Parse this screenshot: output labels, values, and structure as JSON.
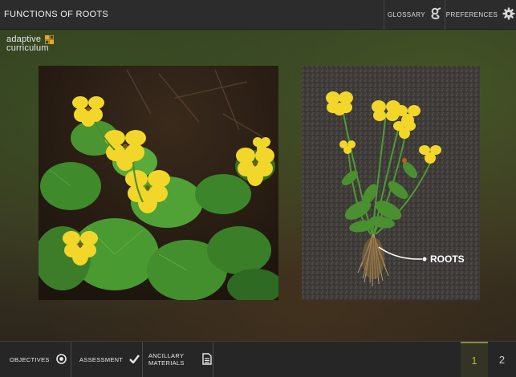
{
  "header": {
    "title": "FUNCTIONS OF ROOTS",
    "glossary_label": "GLOSSARY",
    "preferences_label": "PREFERENCES"
  },
  "logo": {
    "line1": "adaptive",
    "line2": "curriculum"
  },
  "main": {
    "left_image": "yellow-violet-flowers-photo",
    "right_image": "plant-with-roots-photo",
    "annotation": "ROOTS"
  },
  "footer": {
    "objectives_label": "OBJECTIVES",
    "assessment_label": "ASSESSMENT",
    "ancillary_line1": "ANCILLARY",
    "ancillary_line2": "MATERIALS",
    "pages": [
      "1",
      "2"
    ],
    "current_page": "1"
  },
  "colors": {
    "topbar": "#2c2c2c",
    "bottombar": "#262626",
    "active_page": "#b7b33c",
    "flower_yellow": "#f2d72a"
  }
}
